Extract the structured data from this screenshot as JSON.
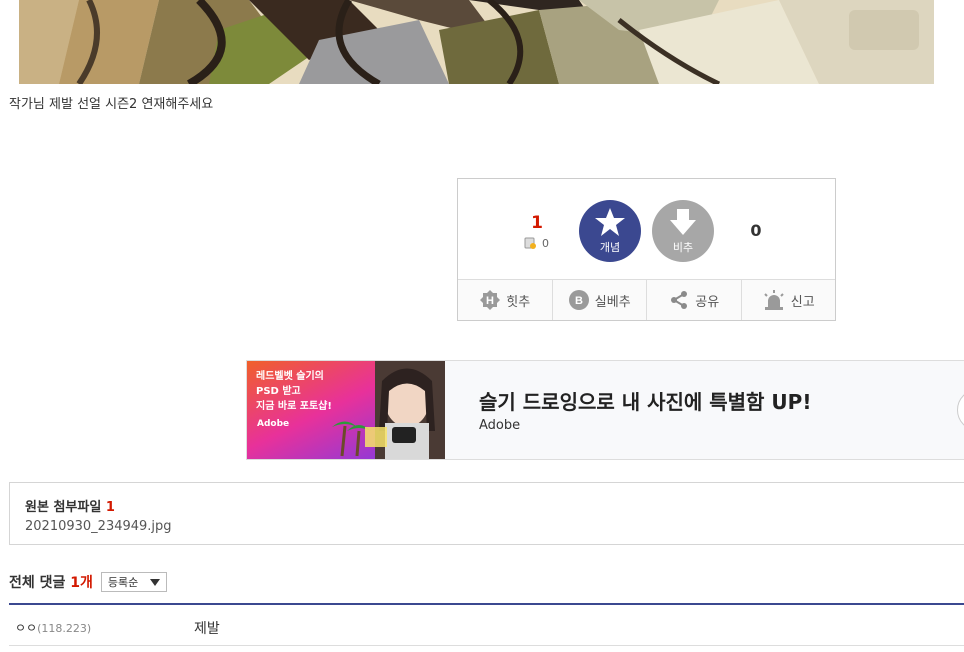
{
  "post": {
    "body_text": "작가님 제발 선얼 시즌2 연재해주세요"
  },
  "vote": {
    "recommend_count": "1",
    "fix_count": "0",
    "up_label": "개념",
    "down_label": "비추",
    "down_count": "0",
    "actions": {
      "hit": "힛추",
      "silbe": "실베추",
      "share": "공유",
      "report": "신고"
    }
  },
  "ad": {
    "image_text_line1": "레드벨벳 슬기의",
    "image_text_line2": "PSD 받고",
    "image_text_line3": "지금 바로 포토샵!",
    "image_logo": "Adobe",
    "headline": "슬기 드로잉으로 내 사진에 특별함 UP!",
    "brand": "Adobe"
  },
  "attachment": {
    "title": "원본 첨부파일",
    "count": "1",
    "filename": "20210930_234949.jpg"
  },
  "comments": {
    "title": "전체 댓글",
    "count": "1개",
    "sort_value": "등록순",
    "items": [
      {
        "nick": "ㅇㅇ",
        "ip": "(118.223)",
        "text": "제발"
      }
    ]
  },
  "colors": {
    "accent_blue": "#3b4890",
    "accent_red": "#d31900",
    "down_gray": "#a7a7a7"
  }
}
